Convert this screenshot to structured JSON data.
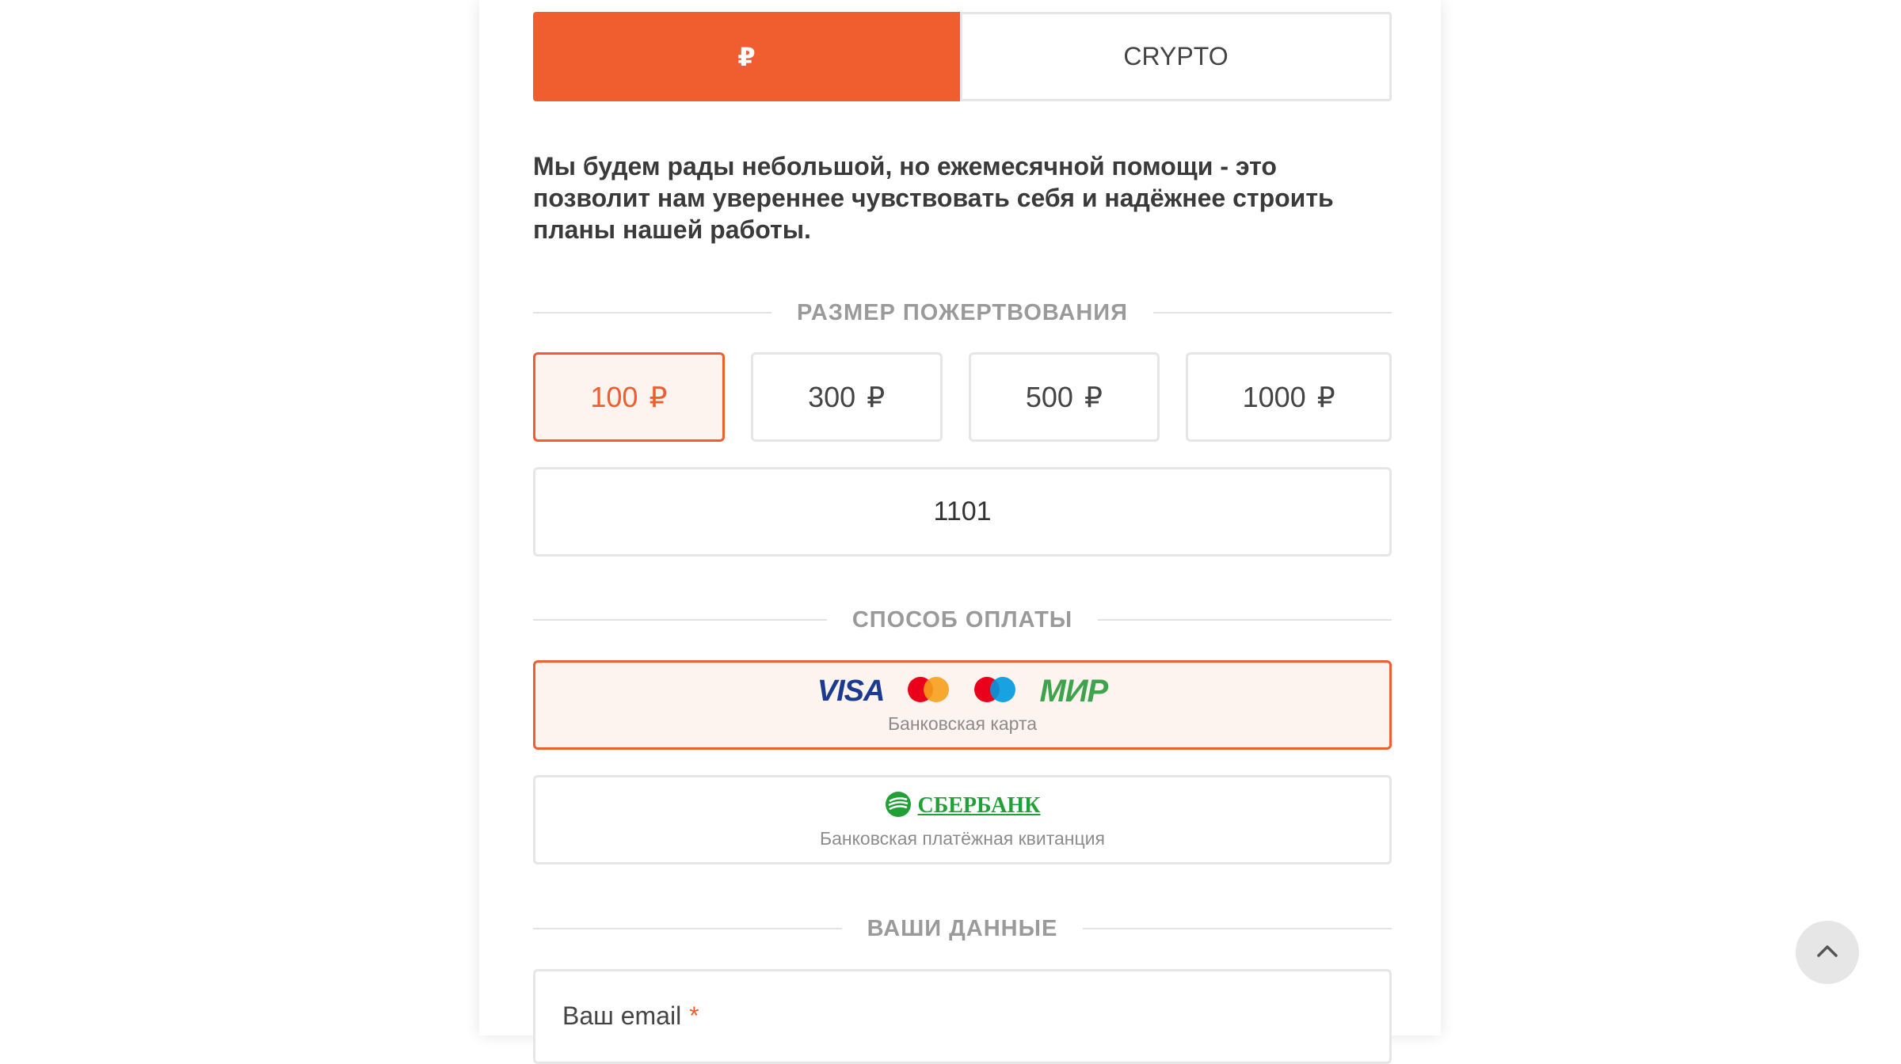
{
  "tabs": [
    {
      "label": "₽",
      "active": true
    },
    {
      "label": "CRYPTO",
      "active": false
    }
  ],
  "intro_text": "Мы будем рады небольшой, но ежемесячной помощи - это позволит нам увереннее чувствовать себя и надёжнее строить планы нашей работы.",
  "donation": {
    "section_title": "РАЗМЕР ПОЖЕРТВОВАНИЯ",
    "amounts": [
      {
        "value": "100",
        "currency": "₽",
        "selected": true
      },
      {
        "value": "300",
        "currency": "₽",
        "selected": false
      },
      {
        "value": "500",
        "currency": "₽",
        "selected": false
      },
      {
        "value": "1000",
        "currency": "₽",
        "selected": false
      }
    ],
    "custom_value": "1101"
  },
  "payment": {
    "section_title": "СПОСОБ ОПЛАТЫ",
    "methods": [
      {
        "label": "Банковская карта",
        "logos": [
          "VISA",
          "mastercard-icon",
          "maestro-icon",
          "МИР"
        ],
        "selected": true
      },
      {
        "label": "Банковская платёжная квитанция",
        "logos": [
          "sberbank-icon"
        ],
        "brand_text": "СБЕРБАНК",
        "selected": false
      }
    ]
  },
  "user": {
    "section_title": "ВАШИ ДАННЫЕ",
    "email_label": "Ваш email",
    "required_mark": "*"
  },
  "icons": {
    "scroll_top": "chevron-up-icon"
  },
  "colors": {
    "accent": "#f05d2e",
    "selected_bg": "#fdf3ef",
    "border": "#e6e6e6",
    "sber_green": "#21a038"
  }
}
